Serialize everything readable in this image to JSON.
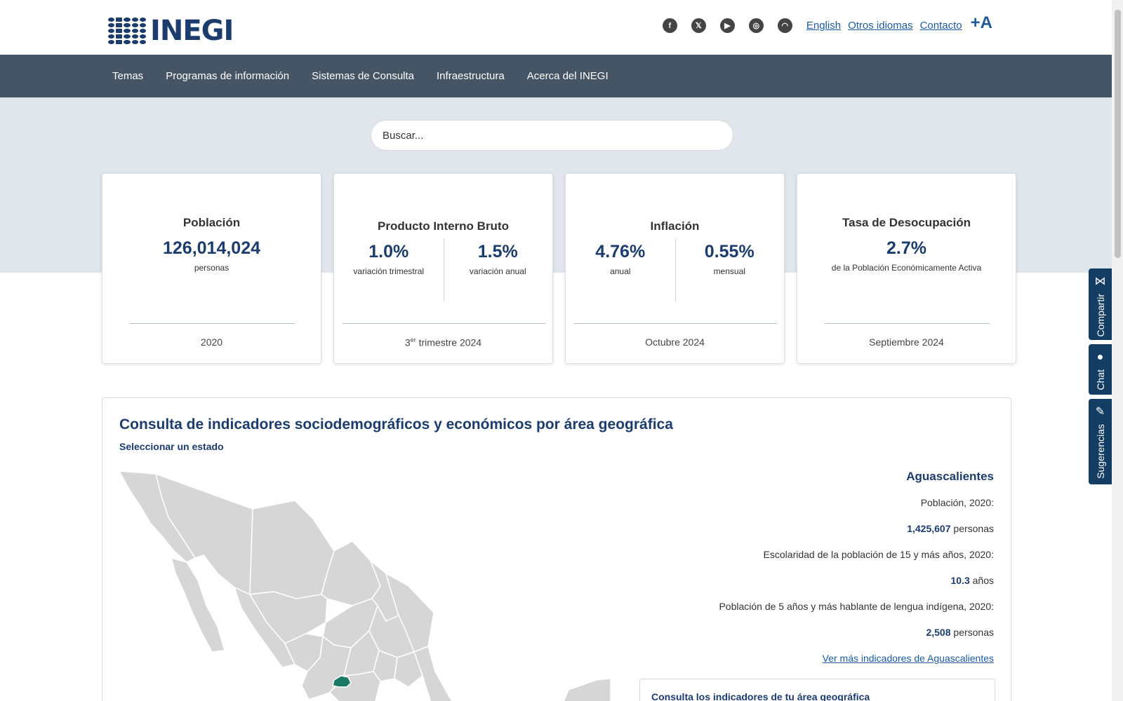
{
  "header": {
    "logo_text": "INEGI",
    "social_icons": [
      "facebook-icon",
      "x-icon",
      "youtube-icon",
      "instagram-icon",
      "rss-icon"
    ],
    "links": {
      "english": "English",
      "otros_idiomas": "Otros idiomas",
      "contacto": "Contacto",
      "font_increase": "+A"
    }
  },
  "nav": {
    "items": [
      "Temas",
      "Programas de información",
      "Sistemas de Consulta",
      "Infraestructura",
      "Acerca del INEGI"
    ]
  },
  "search": {
    "placeholder": "Buscar..."
  },
  "cards": {
    "poblacion": {
      "title": "Población",
      "value": "126,014,024",
      "unit": "personas",
      "footer": "2020"
    },
    "pib": {
      "title": "Producto Interno Bruto",
      "value_a": "1.0%",
      "label_a": "variación trimestral",
      "value_b": "1.5%",
      "label_b": "variación anual",
      "footer_num": "3",
      "footer_sup": "er",
      "footer_rest": " trimestre 2024"
    },
    "inflacion": {
      "title": "Inflación",
      "value_a": "4.76%",
      "label_a": "anual",
      "value_b": "0.55%",
      "label_b": "mensual",
      "footer": "Octubre 2024"
    },
    "desocupacion": {
      "title": "Tasa de Desocupación",
      "value": "2.7%",
      "unit": "de la Población Económicamente Activa",
      "footer": "Septiembre 2024"
    }
  },
  "geo": {
    "title": "Consulta de indicadores sociodemográficos y económicos por área geográfica",
    "subtitle": "Seleccionar un estado",
    "state": "Aguascalientes",
    "pop_label": "Población, 2020:",
    "pop_value": "1,425,607",
    "pop_unit": "personas",
    "esc_label": "Escolaridad de la población de 15 y más años, 2020:",
    "esc_value": "10.3",
    "esc_unit": "años",
    "ind_label": "Población de 5 años y más hablante de lengua indígena, 2020:",
    "ind_value": "2,508",
    "ind_unit": "personas",
    "more_link": "Ver más indicadores de Aguascalientes",
    "box_title": "Consulta los indicadores de tu área geográfica"
  },
  "side_tabs": {
    "compartir": "Compartir",
    "chat": "Chat",
    "sugerencias": "Sugerencias"
  },
  "colors": {
    "nav_bg": "#455565",
    "hero_bg": "#e1e6ec",
    "primary": "#1c3c6e",
    "link": "#1c5a9c",
    "selected_state": "#1a7a66",
    "side_tab": "#143d64"
  }
}
